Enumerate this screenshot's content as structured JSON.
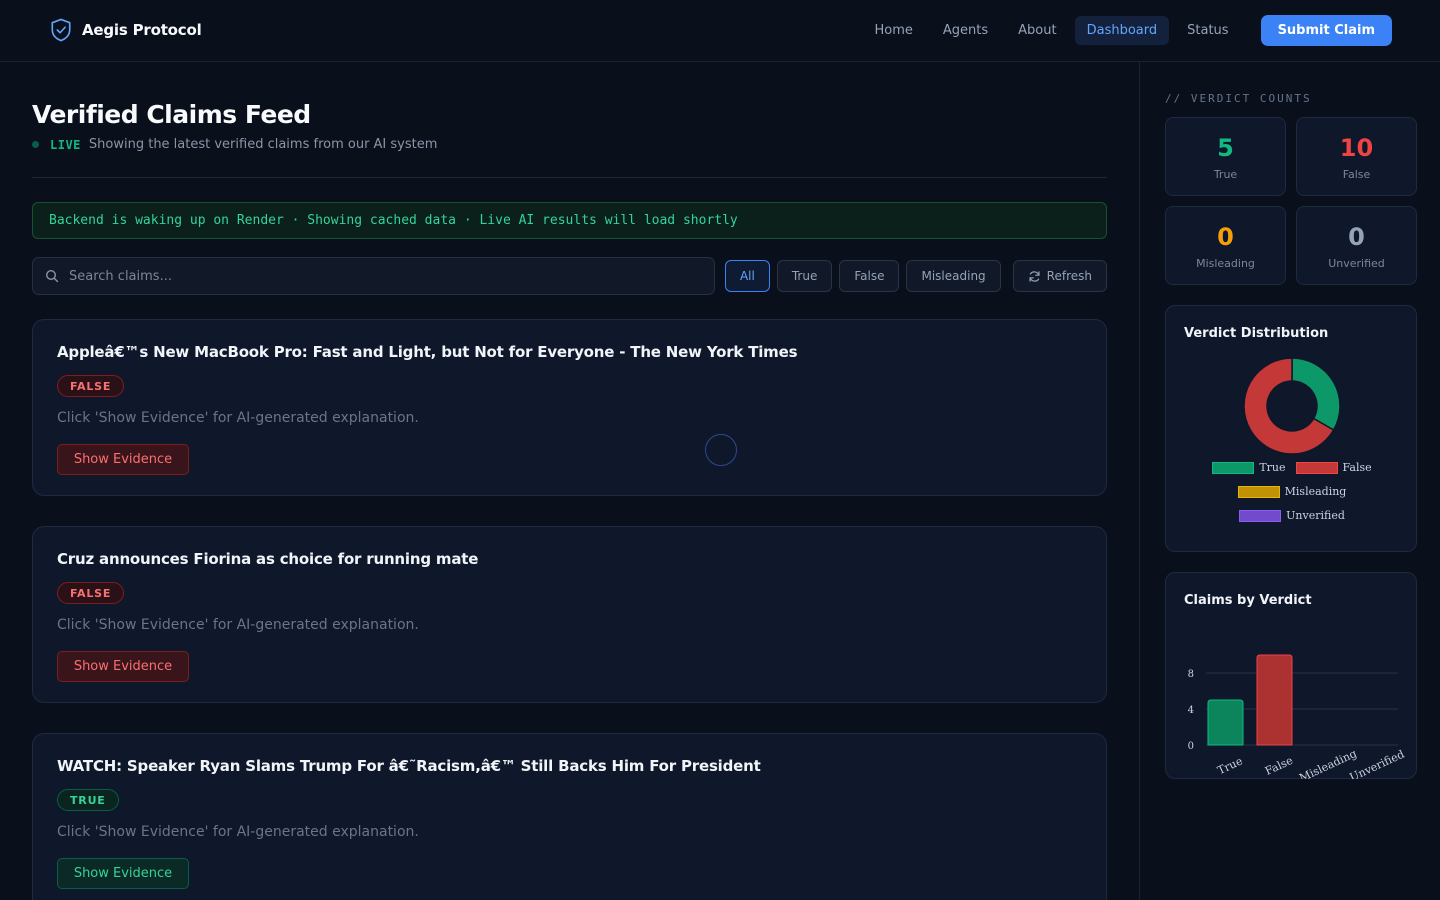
{
  "nav": {
    "brand": "Aegis Protocol",
    "links": [
      "Home",
      "Agents",
      "About",
      "Dashboard",
      "Status"
    ],
    "cta": "Submit Claim"
  },
  "header": {
    "title": "Verified Claims Feed",
    "live": "LIVE",
    "subtitle": "Showing the latest verified claims from our AI system"
  },
  "banner": "Backend is waking up on Render · Showing cached data · Live AI results will load shortly",
  "search": {
    "placeholder": "Search claims..."
  },
  "filters": [
    "All",
    "True",
    "False",
    "Misleading"
  ],
  "refresh_label": "Refresh",
  "claims": [
    {
      "title": "Appleâ€™s New MacBook Pro: Fast and Light, but Not for Everyone - The New York Times",
      "verdict": "FALSE",
      "explanation": "Click 'Show Evidence' for AI-generated explanation.",
      "button": "Show Evidence"
    },
    {
      "title": "Cruz announces Fiorina as choice for running mate",
      "verdict": "FALSE",
      "explanation": "Click 'Show Evidence' for AI-generated explanation.",
      "button": "Show Evidence"
    },
    {
      "title": "WATCH: Speaker Ryan Slams Trump For â€˜Racism,â€™ Still Backs Him For President",
      "verdict": "TRUE",
      "explanation": "Click 'Show Evidence' for AI-generated explanation.",
      "button": "Show Evidence"
    }
  ],
  "sidebar": {
    "heading": "// VERDICT COUNTS",
    "counts": [
      {
        "value": "5",
        "label": "True",
        "color": "#10b981"
      },
      {
        "value": "10",
        "label": "False",
        "color": "#ef4444"
      },
      {
        "value": "0",
        "label": "Misleading",
        "color": "#f59e0b"
      },
      {
        "value": "0",
        "label": "Unverified",
        "color": "#94a3b8"
      }
    ],
    "distribution_title": "Verdict Distribution",
    "bar_title": "Claims by Verdict"
  },
  "chart_data": [
    {
      "type": "pie",
      "title": "Verdict Distribution",
      "categories": [
        "True",
        "False",
        "Misleading",
        "Unverified"
      ],
      "values": [
        5,
        10,
        0,
        0
      ],
      "colors": [
        "#10b981",
        "#ef4444",
        "#eab308",
        "#8b5cf6"
      ],
      "legend": "bottom"
    },
    {
      "type": "bar",
      "title": "Claims by Verdict",
      "categories": [
        "True",
        "False",
        "Misleading",
        "Unverified"
      ],
      "values": [
        5,
        10,
        0,
        0
      ],
      "colors": [
        "#10b981",
        "#ef4444",
        "#eab308",
        "#8b5cf6"
      ],
      "yticks": [
        "0",
        "4",
        "8"
      ],
      "ylim": [
        0,
        10
      ],
      "grid": true
    }
  ]
}
